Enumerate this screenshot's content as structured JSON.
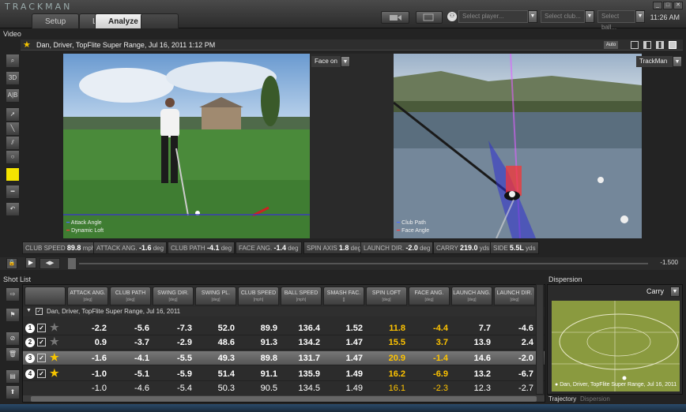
{
  "app": {
    "logo": "TRACKMAN",
    "clock": "11:26 AM"
  },
  "tabs": [
    {
      "label": "Setup"
    },
    {
      "label": "Live"
    },
    {
      "label": "Analyze"
    }
  ],
  "toolbar": {
    "player_placeholder": "Select player...",
    "club_placeholder": "Select club...",
    "ball_placeholder": "Select ball..."
  },
  "video": {
    "section_label": "Video",
    "title": "Dan, Driver, TopFlite Super Range, Jul 16, 2011 1:12 PM",
    "auto_label": "Auto",
    "face_on_label": "Face on",
    "trackman_label": "TrackMan",
    "left_legend": [
      "Attack Angle",
      "Dynamic Loft"
    ],
    "right_legend": [
      "Club Path",
      "Face Angle"
    ]
  },
  "params": [
    {
      "label": "CLUB SPEED",
      "value": "89.8",
      "unit": "mph"
    },
    {
      "label": "ATTACK ANG.",
      "value": "-1.6",
      "unit": "deg"
    },
    {
      "label": "CLUB PATH",
      "value": "-4.1",
      "unit": "deg"
    },
    {
      "label": "FACE ANG.",
      "value": "-1.4",
      "unit": "deg"
    },
    {
      "label": "SPIN AXIS",
      "value": "1.8",
      "unit": "deg"
    },
    {
      "label": "LAUNCH DIR.",
      "value": "-2.0",
      "unit": "deg"
    },
    {
      "label": "CARRY",
      "value": "219.0",
      "unit": "yds"
    },
    {
      "label": "SIDE",
      "value": "5.5L",
      "unit": "yds"
    }
  ],
  "playback": {
    "time": "-1.500"
  },
  "shot_list": {
    "label": "Shot List",
    "group_label": "Dan, Driver, TopFlite Super Range, Jul 16, 2011",
    "columns": [
      {
        "name": "ATTACK ANG.",
        "unit": "[deg]"
      },
      {
        "name": "CLUB PATH",
        "unit": "[deg]"
      },
      {
        "name": "SWING DIR.",
        "unit": "[deg]"
      },
      {
        "name": "SWING PL.",
        "unit": "[deg]"
      },
      {
        "name": "CLUB SPEED",
        "unit": "[mph]"
      },
      {
        "name": "BALL SPEED",
        "unit": "[mph]"
      },
      {
        "name": "SMASH FAC.",
        "unit": "[]"
      },
      {
        "name": "SPIN LOFT",
        "unit": "[deg]"
      },
      {
        "name": "FACE ANG.",
        "unit": "[deg]"
      },
      {
        "name": "LAUNCH ANG.",
        "unit": "[deg]"
      },
      {
        "name": "LAUNCH DIR.",
        "unit": "[deg]"
      }
    ],
    "rows": [
      {
        "num": "1",
        "values": [
          "-2.2",
          "-5.6",
          "-7.3",
          "52.0",
          "89.9",
          "136.4",
          "1.52",
          "11.8",
          "-4.4",
          "7.7",
          "-4.6"
        ]
      },
      {
        "num": "2",
        "values": [
          "0.9",
          "-3.7",
          "-2.9",
          "48.6",
          "91.3",
          "134.2",
          "1.47",
          "15.5",
          "3.7",
          "13.9",
          "2.4"
        ]
      },
      {
        "num": "3",
        "values": [
          "-1.6",
          "-4.1",
          "-5.5",
          "49.3",
          "89.8",
          "131.7",
          "1.47",
          "20.9",
          "-1.4",
          "14.6",
          "-2.0"
        ]
      },
      {
        "num": "4",
        "values": [
          "-1.0",
          "-5.1",
          "-5.9",
          "51.4",
          "91.1",
          "135.9",
          "1.49",
          "16.2",
          "-6.9",
          "13.2",
          "-6.7"
        ]
      }
    ],
    "average": [
      "-1.0",
      "-4.6",
      "-5.4",
      "50.3",
      "90.5",
      "134.5",
      "1.49",
      "16.1",
      "-2.3",
      "12.3",
      "-2.7"
    ]
  },
  "dispersion": {
    "label": "Dispersion",
    "mode": "Carry",
    "legend": "Dan, Driver, TopFlite Super Range, Jul 16, 2011",
    "tabs": [
      "Trajectory",
      "Dispersion"
    ]
  },
  "colors": {
    "highlight_value": "#ffc400",
    "star": "#f5c400"
  }
}
